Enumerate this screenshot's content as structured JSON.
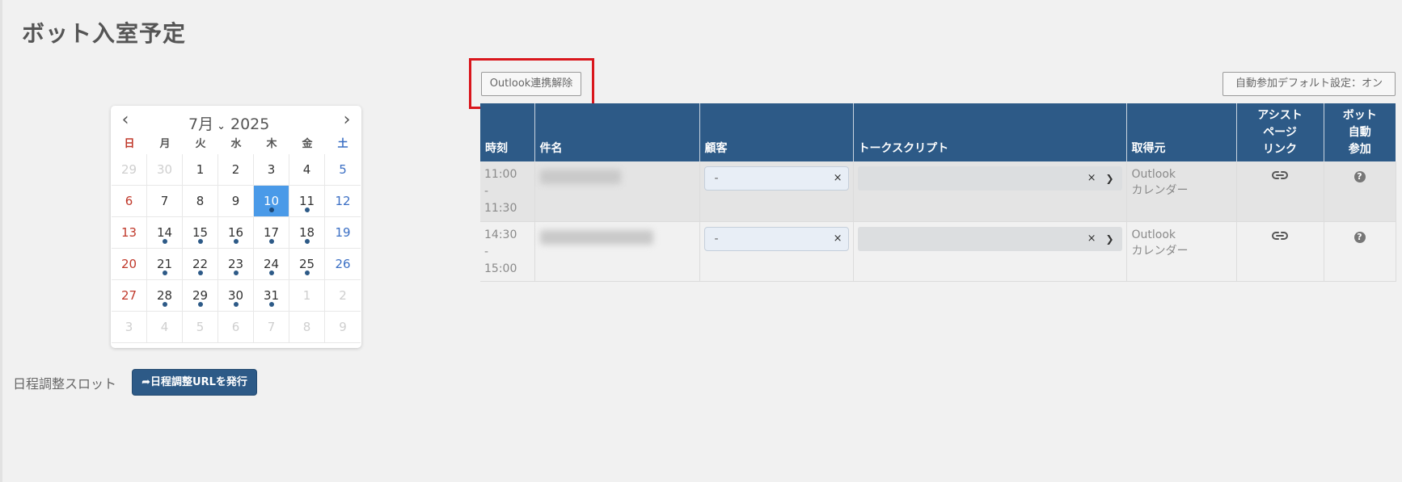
{
  "page": {
    "title": "ボット入室予定"
  },
  "calendar": {
    "month_label": "7月",
    "year_label": "2025",
    "weekdays": [
      "日",
      "月",
      "火",
      "水",
      "木",
      "金",
      "土"
    ],
    "days": [
      {
        "d": "29",
        "muted": true
      },
      {
        "d": "30",
        "muted": true
      },
      {
        "d": "1"
      },
      {
        "d": "2"
      },
      {
        "d": "3"
      },
      {
        "d": "4"
      },
      {
        "d": "5"
      },
      {
        "d": "6"
      },
      {
        "d": "7"
      },
      {
        "d": "8"
      },
      {
        "d": "9"
      },
      {
        "d": "10",
        "selected": true,
        "dot": true
      },
      {
        "d": "11",
        "dot": true
      },
      {
        "d": "12"
      },
      {
        "d": "13"
      },
      {
        "d": "14",
        "dot": true
      },
      {
        "d": "15",
        "dot": true
      },
      {
        "d": "16",
        "dot": true
      },
      {
        "d": "17",
        "dot": true
      },
      {
        "d": "18",
        "dot": true
      },
      {
        "d": "19"
      },
      {
        "d": "20"
      },
      {
        "d": "21",
        "dot": true
      },
      {
        "d": "22",
        "dot": true
      },
      {
        "d": "23",
        "dot": true
      },
      {
        "d": "24",
        "dot": true
      },
      {
        "d": "25",
        "dot": true
      },
      {
        "d": "26"
      },
      {
        "d": "27"
      },
      {
        "d": "28",
        "dot": true
      },
      {
        "d": "29",
        "dot": true
      },
      {
        "d": "30",
        "dot": true
      },
      {
        "d": "31",
        "dot": true
      },
      {
        "d": "1",
        "muted": true
      },
      {
        "d": "2",
        "muted": true
      },
      {
        "d": "3",
        "muted": true
      },
      {
        "d": "4",
        "muted": true
      },
      {
        "d": "5",
        "muted": true
      },
      {
        "d": "6",
        "muted": true
      },
      {
        "d": "7",
        "muted": true
      },
      {
        "d": "8",
        "muted": true
      },
      {
        "d": "9",
        "muted": true
      }
    ]
  },
  "slot": {
    "label": "日程調整スロット",
    "button_label": "日程調整URLを発行"
  },
  "toolbar": {
    "outlook_label": "Outlook連携解除",
    "auto_join_label": "自動参加デフォルト設定：オン"
  },
  "table": {
    "headers": {
      "time": "時刻",
      "subject": "件名",
      "customer": "顧客",
      "script": "トークスクリプト",
      "source": "取得元",
      "assist_l1": "アシスト",
      "assist_l2": "ページ",
      "assist_l3": "リンク",
      "bot_l1": "ボット",
      "bot_l2": "自動",
      "bot_l3": "参加"
    },
    "rows": [
      {
        "time_start": "11:00",
        "time_sep": "-",
        "time_end": "11:30",
        "customer": "-",
        "clear": "×",
        "source_l1": "Outlook",
        "source_l2": "カレンダー"
      },
      {
        "time_start": "14:30",
        "time_sep": "-",
        "time_end": "15:00",
        "customer": "-",
        "clear": "×",
        "source_l1": "Outlook",
        "source_l2": "カレンダー"
      }
    ]
  },
  "colors": {
    "header_bg": "#2d5a87",
    "selected_day": "#4a9ae8",
    "highlight_box": "#d9161c"
  }
}
